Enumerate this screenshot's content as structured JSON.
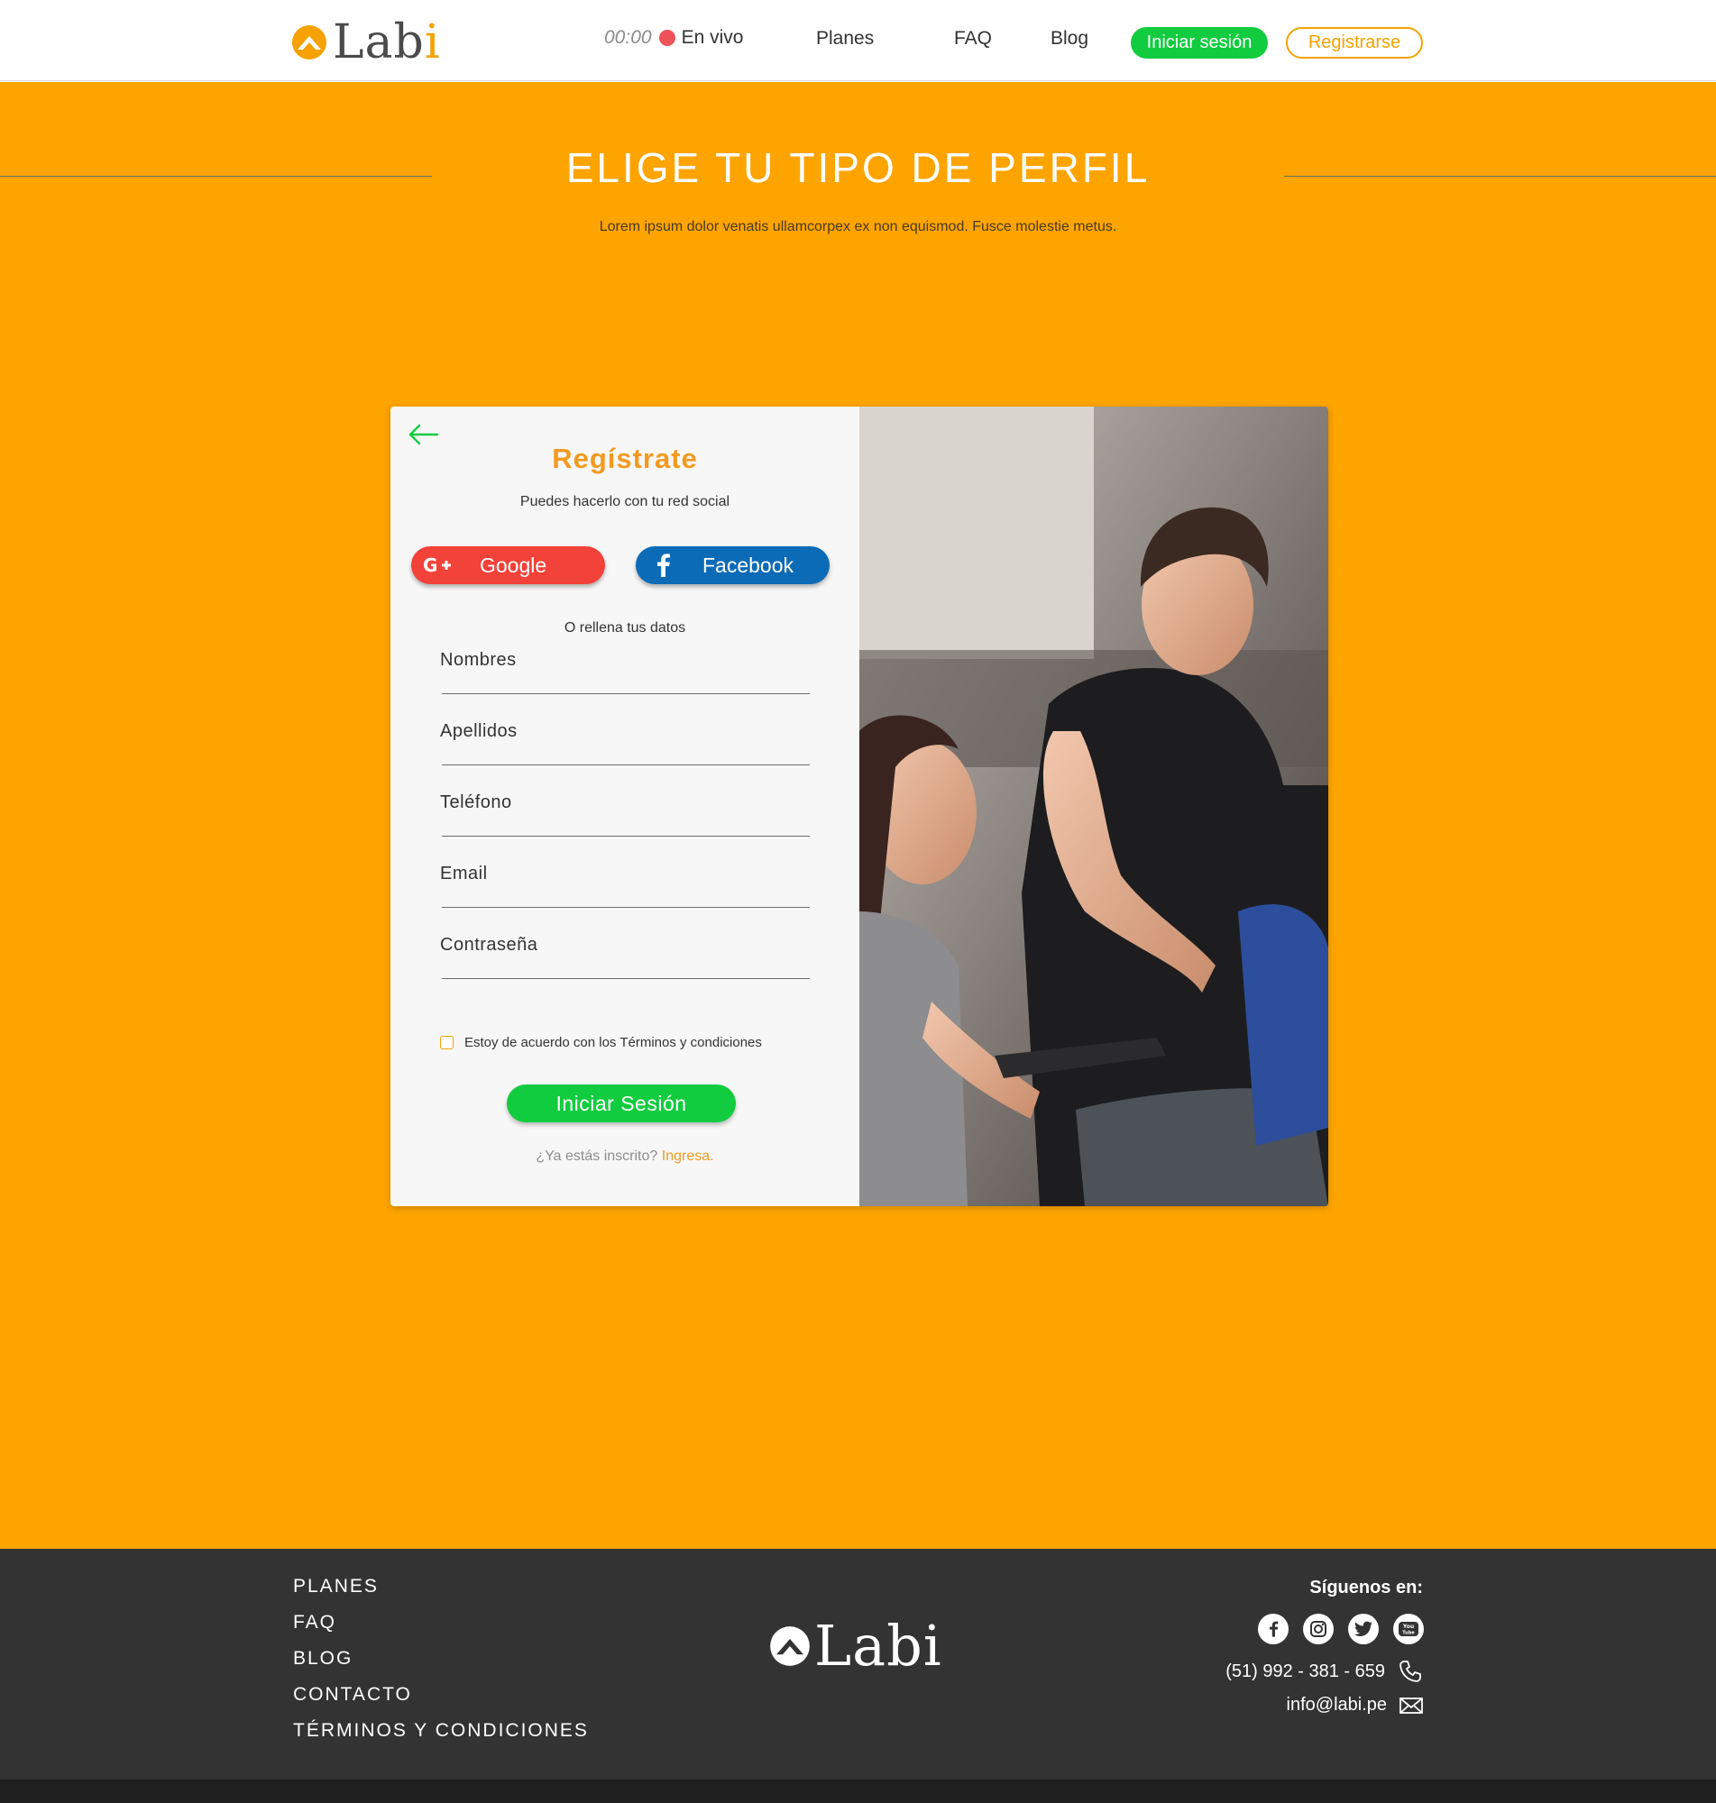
{
  "header": {
    "logo_text": "Lab",
    "logo_accent": "i",
    "live_time": "00:00",
    "live_label": "En vivo",
    "nav": [
      "Planes",
      "FAQ",
      "Blog"
    ],
    "login_label": "Iniciar sesión",
    "register_label": "Registrarse"
  },
  "hero": {
    "title": "ELIGE TU TIPO DE PERFIL",
    "subtitle": "Lorem ipsum dolor venatis ullamcorpex ex non equismod. Fusce molestie metus."
  },
  "form": {
    "title": "Regístrate",
    "social_prompt": "Puedes hacerlo con tu red social",
    "google_label": "Google",
    "facebook_label": "Facebook",
    "or_label": "O rellena tus datos",
    "fields": [
      "Nombres",
      "Apellidos",
      "Teléfono",
      "Email",
      "Contraseña"
    ],
    "terms_label": "Estoy de acuerdo con los Términos y condiciones",
    "submit_label": "Iniciar Sesión",
    "signin_prompt": "¿Ya estás inscrito?",
    "signin_link": "Ingresa."
  },
  "footer": {
    "links": [
      "PLANES",
      "FAQ",
      "BLOG",
      "CONTACTO",
      "TÉRMINOS Y CONDICIONES"
    ],
    "logo_text": "Labi",
    "follow_label": "Síguenos en:",
    "social": [
      "facebook-icon",
      "instagram-icon",
      "twitter-icon",
      "youtube-icon"
    ],
    "phone": "(51) 992 - 381 - 659",
    "email": "info@labi.pe"
  },
  "colors": {
    "brand_orange": "#fea400",
    "accent_green": "#12cc3f",
    "google_red": "#f34239",
    "facebook_blue": "#0c6bb6",
    "footer_dark": "#333333"
  }
}
